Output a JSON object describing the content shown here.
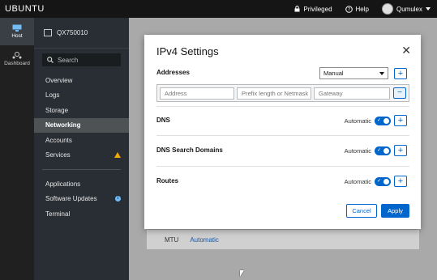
{
  "topbar": {
    "brand": "UBUNTU",
    "privileged_label": "Privileged",
    "help_label": "Help",
    "user_label": "Qumulex"
  },
  "rail": {
    "items": [
      {
        "label": "Host",
        "icon": "host-icon",
        "active": true
      },
      {
        "label": "Dashboard",
        "icon": "dashboard-icon",
        "active": false
      }
    ]
  },
  "nav": {
    "host_name": "QX750010",
    "search_placeholder": "Search",
    "items": [
      {
        "label": "Overview"
      },
      {
        "label": "Logs"
      },
      {
        "label": "Storage"
      },
      {
        "label": "Networking",
        "active": true
      },
      {
        "label": "Accounts"
      },
      {
        "label": "Services",
        "badge": "warning-icon"
      }
    ],
    "items2": [
      {
        "label": "Applications"
      },
      {
        "label": "Software Updates",
        "badge": "info-icon"
      },
      {
        "label": "Terminal"
      }
    ]
  },
  "background": {
    "mtu_label": "MTU",
    "mtu_value": "Automatic"
  },
  "modal": {
    "title": "IPv4 Settings",
    "addresses_label": "Addresses",
    "method_value": "Manual",
    "address_placeholder": "Address",
    "prefix_placeholder": "Prefix length or Netmask",
    "gateway_placeholder": "Gateway",
    "dns_label": "DNS",
    "dns_search_label": "DNS Search Domains",
    "routes_label": "Routes",
    "automatic_label": "Automatic",
    "add_symbol": "+",
    "remove_symbol": "−",
    "close_symbol": "✕",
    "cancel_label": "Cancel",
    "apply_label": "Apply"
  },
  "colors": {
    "accent": "#0066cc",
    "topbar": "#151515",
    "nav": "#292e34",
    "warning": "#f0ab00",
    "info": "#73bcf7"
  }
}
